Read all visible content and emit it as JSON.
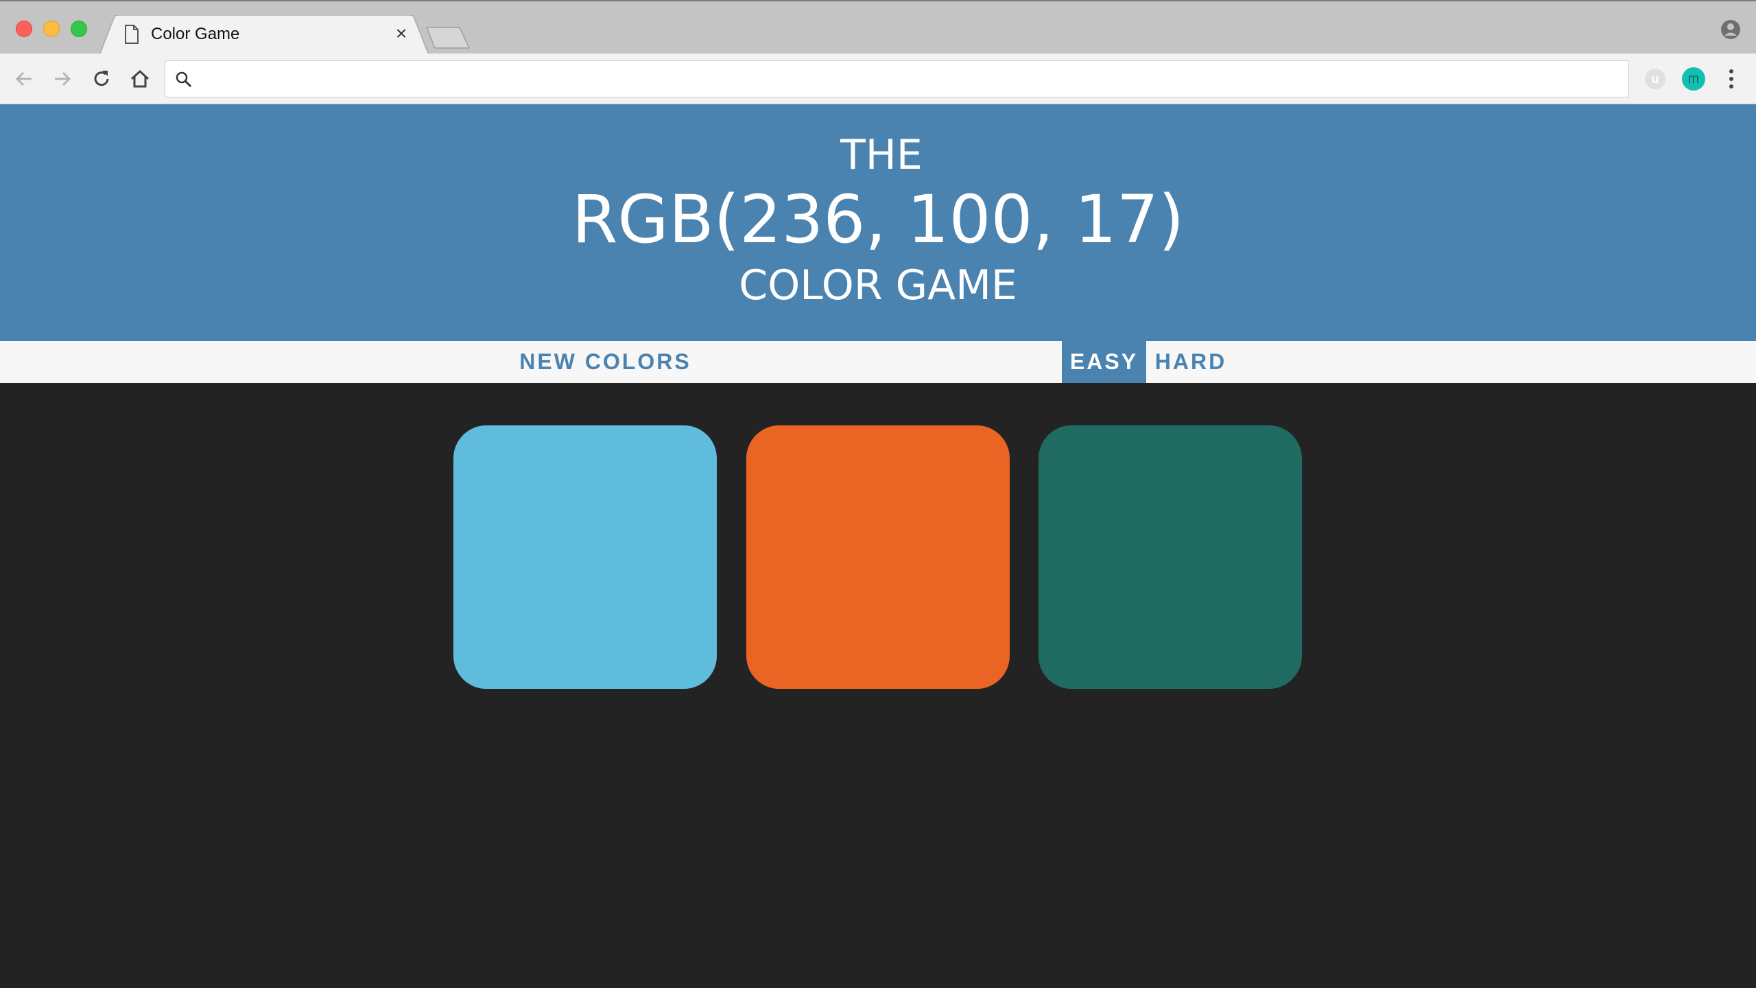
{
  "browser": {
    "tab_title": "Color Game",
    "tab_close": "×",
    "address_value": "",
    "extensions": [
      "u",
      "m"
    ]
  },
  "header": {
    "line1": "THE",
    "rgb_display": "RGB(236, 100, 17)",
    "line3": "COLOR GAME",
    "background_color": "#4a82b0"
  },
  "controls": {
    "new_colors_label": "NEW COLORS",
    "message": "",
    "easy_label": "EASY",
    "hard_label": "HARD",
    "selected_mode": "EASY"
  },
  "squares": [
    {
      "color": "#5fbcdd"
    },
    {
      "color": "#ea6423"
    },
    {
      "color": "#1f6b62"
    }
  ],
  "page_background": "#232323"
}
